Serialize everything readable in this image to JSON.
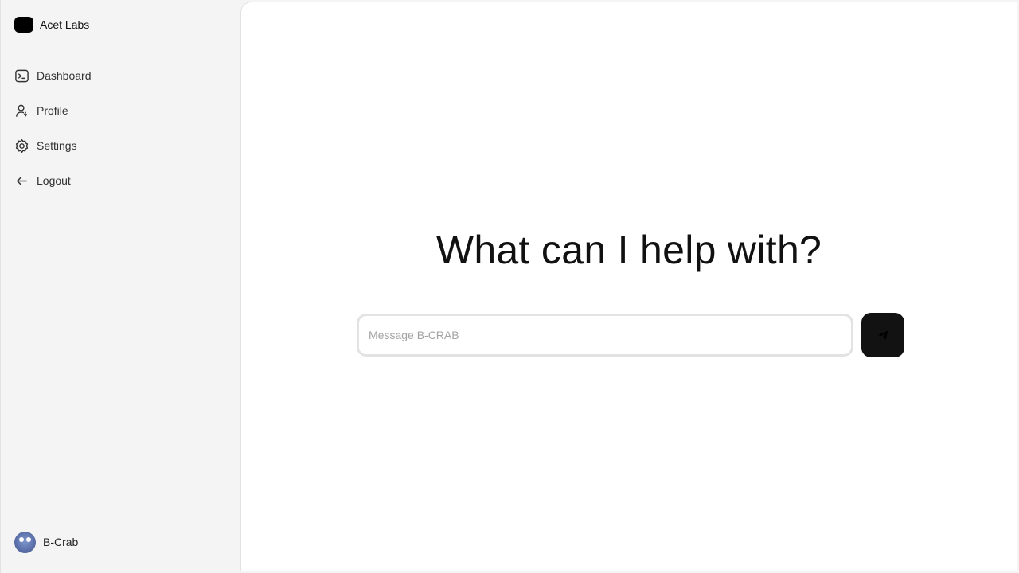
{
  "brand": {
    "name": "Acet Labs"
  },
  "sidebar": {
    "items": [
      {
        "label": "Dashboard",
        "icon": "terminal-icon"
      },
      {
        "label": "Profile",
        "icon": "user-icon"
      },
      {
        "label": "Settings",
        "icon": "gear-icon"
      },
      {
        "label": "Logout",
        "icon": "arrow-left-icon"
      }
    ]
  },
  "user": {
    "name": "B-Crab",
    "icon": "crab-avatar"
  },
  "main": {
    "headline": "What can I help with?",
    "composer": {
      "placeholder": "Message B-CRAB",
      "value": ""
    },
    "send_icon": "paper-plane-icon"
  },
  "colors": {
    "sidebar_bg": "#f4f4f4",
    "main_bg": "#ffffff",
    "button_bg": "#121212",
    "logo": "#000000"
  }
}
